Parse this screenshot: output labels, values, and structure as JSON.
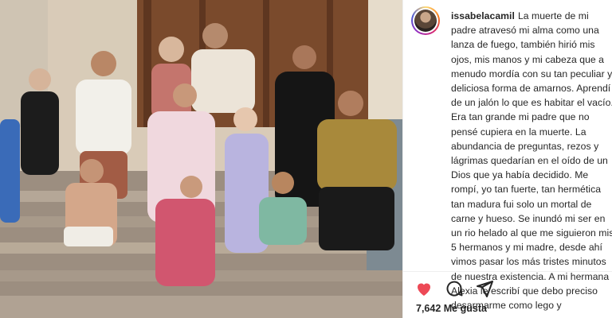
{
  "post": {
    "username": "issabelacamil",
    "caption": "La muerte de mi padre atravesó mi alma como una lanza de fuego, también hirió mis ojos, mis manos y mi cabeza que a menudo mordía con su tan peculiar y deliciosa forma de amarnos. Aprendí de un jalón lo que es habitar el vacío. Era tan grande mi padre que no pensé cupiera en la muerte. La abundancia de preguntas, rezos y lágrimas quedarían en el oído de un Dios que ya había decidido. Me rompí, yo tan fuerte, tan hermética tan madura fui solo un mortal de carne y hueso. Se inundó mi ser en un rio helado al que me siguieron mis 5 hermanos y mi madre, desde ahí vimos pasar los más tristes minutos de nuestra existencia. A mi hermana Alexia le escribí que debo preciso desarmarme como lego y",
    "likes": "7,642 Me gusta",
    "icons": [
      "heart-icon",
      "comment-icon",
      "share-icon"
    ],
    "like_color": "#ed4956"
  }
}
